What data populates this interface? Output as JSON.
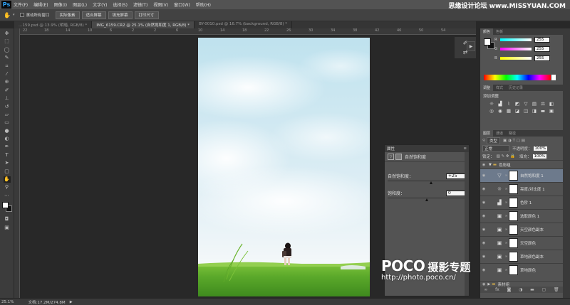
{
  "app": {
    "logo": "Ps"
  },
  "menu": [
    "文件(F)",
    "编辑(E)",
    "图像(I)",
    "图层(L)",
    "文字(Y)",
    "选择(S)",
    "滤镜(T)",
    "视图(V)",
    "窗口(W)",
    "帮助(H)"
  ],
  "watermark_top": "思缘设计论坛 www.MISSYUAN.COM",
  "options": {
    "scroll_all": "滚动所有窗口",
    "buttons": [
      "实际像素",
      "适合屏幕",
      "填充屏幕",
      "打印尺寸"
    ]
  },
  "tabs": [
    {
      "label": "…159.psd @ 13.9% (明暗, RGB/8) *",
      "active": false
    },
    {
      "label": "IMG_6159.CR2 @ 25.1% (自然饱和度 1, RGB/8) *",
      "active": true
    },
    {
      "label": "BY-0010.psd @ 16.7% (background, RGB/8) *",
      "active": false
    }
  ],
  "hruler": [
    "22",
    "18",
    "14",
    "10",
    "6",
    "2",
    "2",
    "6",
    "10",
    "14",
    "18",
    "22",
    "26",
    "30",
    "34",
    "38",
    "42",
    "46",
    "50",
    "54"
  ],
  "tools": [
    "move-tool",
    "marquee-tool",
    "lasso-tool",
    "quick-select-tool",
    "crop-tool",
    "eyedropper-tool",
    "healing-tool",
    "brush-tool",
    "stamp-tool",
    "history-brush-tool",
    "eraser-tool",
    "gradient-tool",
    "blur-tool",
    "dodge-tool",
    "pen-tool",
    "type-tool",
    "path-select-tool",
    "shape-tool",
    "hand-tool",
    "zoom-tool"
  ],
  "properties": {
    "tab": "属性",
    "title": "自然饱和度",
    "vibrance_label": "自然饱和度：",
    "vibrance_value": "+25",
    "vibrance_fraction": 0.56,
    "saturation_label": "饱和度：",
    "saturation_value": "0",
    "saturation_fraction": 0.5
  },
  "color_panel": {
    "tabs": [
      "颜色",
      "色板"
    ],
    "labels": [
      "R",
      "G",
      "B"
    ],
    "values": [
      "255",
      "255",
      "255"
    ]
  },
  "adjustments_panel": {
    "tabs": [
      "调整",
      "样式",
      "历史记录"
    ],
    "title": "添加调整"
  },
  "layers_panel": {
    "tabs": [
      "图层",
      "通道",
      "路径"
    ],
    "filter_kind": "类型",
    "blend_mode": "正常",
    "opacity_label": "不透明度：",
    "opacity_value": "100%",
    "lock_label": "锁定：",
    "fill_label": "填充：",
    "fill_value": "100%",
    "group_name": "色彩组",
    "layers": [
      {
        "name": "自然饱和度 1",
        "icon": "vibrance-icon",
        "selected": true
      },
      {
        "name": "亮度/对比度 1",
        "icon": "brightness-icon",
        "selected": false
      },
      {
        "name": "色阶 1",
        "icon": "levels-icon",
        "selected": false
      },
      {
        "name": "选取颜色 1",
        "icon": "selective-color-icon",
        "selected": false
      },
      {
        "name": "天空颜色副本",
        "icon": "selective-color-icon",
        "selected": false
      },
      {
        "name": "天空颜色",
        "icon": "selective-color-icon",
        "selected": false
      },
      {
        "name": "草地颜色副本",
        "icon": "selective-color-icon",
        "selected": false
      },
      {
        "name": "草地颜色",
        "icon": "selective-color-icon",
        "selected": false
      }
    ],
    "bottom_group": "素材组"
  },
  "status": {
    "zoom": "25.1%",
    "doc": "文档:17.2M/274.8M"
  },
  "poco": {
    "brand": "POCO",
    "subtitle": "摄影专题",
    "url": "http://photo.poco.cn/"
  },
  "colors": {
    "accent_selected": "#6d7a8c",
    "panel": "#535353",
    "ps_blue": "#31a8ff"
  }
}
